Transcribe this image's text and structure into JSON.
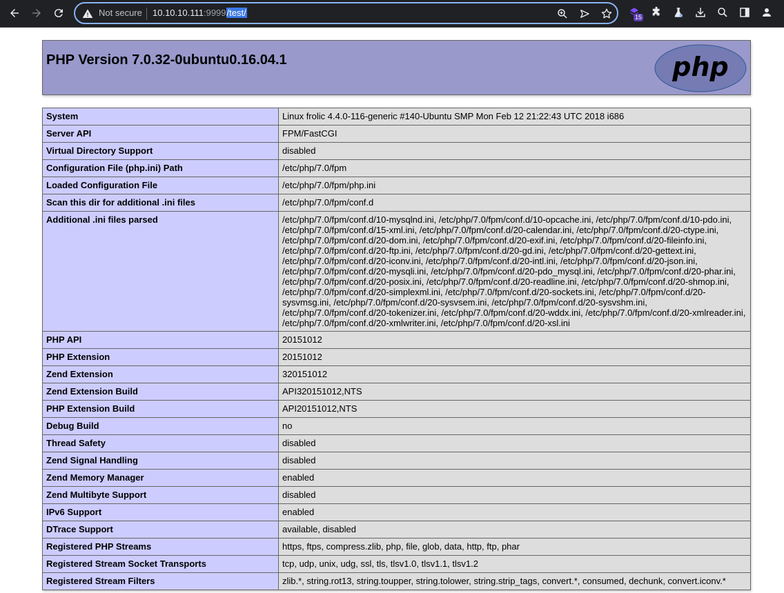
{
  "browser": {
    "security_label": "Not secure",
    "url_host": "10.10.10.111",
    "url_port": ":9999",
    "url_path": "/test/",
    "extension_badge": "15",
    "icons": [
      "back-icon",
      "forward-icon",
      "reload-icon",
      "warning-icon",
      "zoom-icon",
      "send-icon",
      "star-icon",
      "extension-icon",
      "puzzle-icon",
      "lab-icon",
      "download-icon",
      "search-icon",
      "sidepanel-icon",
      "profile-icon"
    ]
  },
  "header": {
    "title": "PHP Version 7.0.32-0ubuntu0.16.04.1",
    "logo_text": "php"
  },
  "rows": [
    {
      "k": "System",
      "v": "Linux frolic 4.4.0-116-generic #140-Ubuntu SMP Mon Feb 12 21:22:43 UTC 2018 i686"
    },
    {
      "k": "Server API",
      "v": "FPM/FastCGI"
    },
    {
      "k": "Virtual Directory Support",
      "v": "disabled"
    },
    {
      "k": "Configuration File (php.ini) Path",
      "v": "/etc/php/7.0/fpm"
    },
    {
      "k": "Loaded Configuration File",
      "v": "/etc/php/7.0/fpm/php.ini"
    },
    {
      "k": "Scan this dir for additional .ini files",
      "v": "/etc/php/7.0/fpm/conf.d"
    },
    {
      "k": "Additional .ini files parsed",
      "v": "/etc/php/7.0/fpm/conf.d/10-mysqlnd.ini, /etc/php/7.0/fpm/conf.d/10-opcache.ini, /etc/php/7.0/fpm/conf.d/10-pdo.ini, /etc/php/7.0/fpm/conf.d/15-xml.ini, /etc/php/7.0/fpm/conf.d/20-calendar.ini, /etc/php/7.0/fpm/conf.d/20-ctype.ini, /etc/php/7.0/fpm/conf.d/20-dom.ini, /etc/php/7.0/fpm/conf.d/20-exif.ini, /etc/php/7.0/fpm/conf.d/20-fileinfo.ini, /etc/php/7.0/fpm/conf.d/20-ftp.ini, /etc/php/7.0/fpm/conf.d/20-gd.ini, /etc/php/7.0/fpm/conf.d/20-gettext.ini, /etc/php/7.0/fpm/conf.d/20-iconv.ini, /etc/php/7.0/fpm/conf.d/20-intl.ini, /etc/php/7.0/fpm/conf.d/20-json.ini, /etc/php/7.0/fpm/conf.d/20-mysqli.ini, /etc/php/7.0/fpm/conf.d/20-pdo_mysql.ini, /etc/php/7.0/fpm/conf.d/20-phar.ini, /etc/php/7.0/fpm/conf.d/20-posix.ini, /etc/php/7.0/fpm/conf.d/20-readline.ini, /etc/php/7.0/fpm/conf.d/20-shmop.ini, /etc/php/7.0/fpm/conf.d/20-simplexml.ini, /etc/php/7.0/fpm/conf.d/20-sockets.ini, /etc/php/7.0/fpm/conf.d/20-sysvmsg.ini, /etc/php/7.0/fpm/conf.d/20-sysvsem.ini, /etc/php/7.0/fpm/conf.d/20-sysvshm.ini, /etc/php/7.0/fpm/conf.d/20-tokenizer.ini, /etc/php/7.0/fpm/conf.d/20-wddx.ini, /etc/php/7.0/fpm/conf.d/20-xmlreader.ini, /etc/php/7.0/fpm/conf.d/20-xmlwriter.ini, /etc/php/7.0/fpm/conf.d/20-xsl.ini"
    },
    {
      "k": "PHP API",
      "v": "20151012"
    },
    {
      "k": "PHP Extension",
      "v": "20151012"
    },
    {
      "k": "Zend Extension",
      "v": "320151012"
    },
    {
      "k": "Zend Extension Build",
      "v": "API320151012,NTS"
    },
    {
      "k": "PHP Extension Build",
      "v": "API20151012,NTS"
    },
    {
      "k": "Debug Build",
      "v": "no"
    },
    {
      "k": "Thread Safety",
      "v": "disabled"
    },
    {
      "k": "Zend Signal Handling",
      "v": "disabled"
    },
    {
      "k": "Zend Memory Manager",
      "v": "enabled"
    },
    {
      "k": "Zend Multibyte Support",
      "v": "disabled"
    },
    {
      "k": "IPv6 Support",
      "v": "enabled"
    },
    {
      "k": "DTrace Support",
      "v": "available, disabled"
    },
    {
      "k": "Registered PHP Streams",
      "v": "https, ftps, compress.zlib, php, file, glob, data, http, ftp, phar"
    },
    {
      "k": "Registered Stream Socket Transports",
      "v": "tcp, udp, unix, udg, ssl, tls, tlsv1.0, tlsv1.1, tlsv1.2"
    },
    {
      "k": "Registered Stream Filters",
      "v": "zlib.*, string.rot13, string.toupper, string.tolower, string.strip_tags, convert.*, consumed, dechunk, convert.iconv.*"
    }
  ]
}
